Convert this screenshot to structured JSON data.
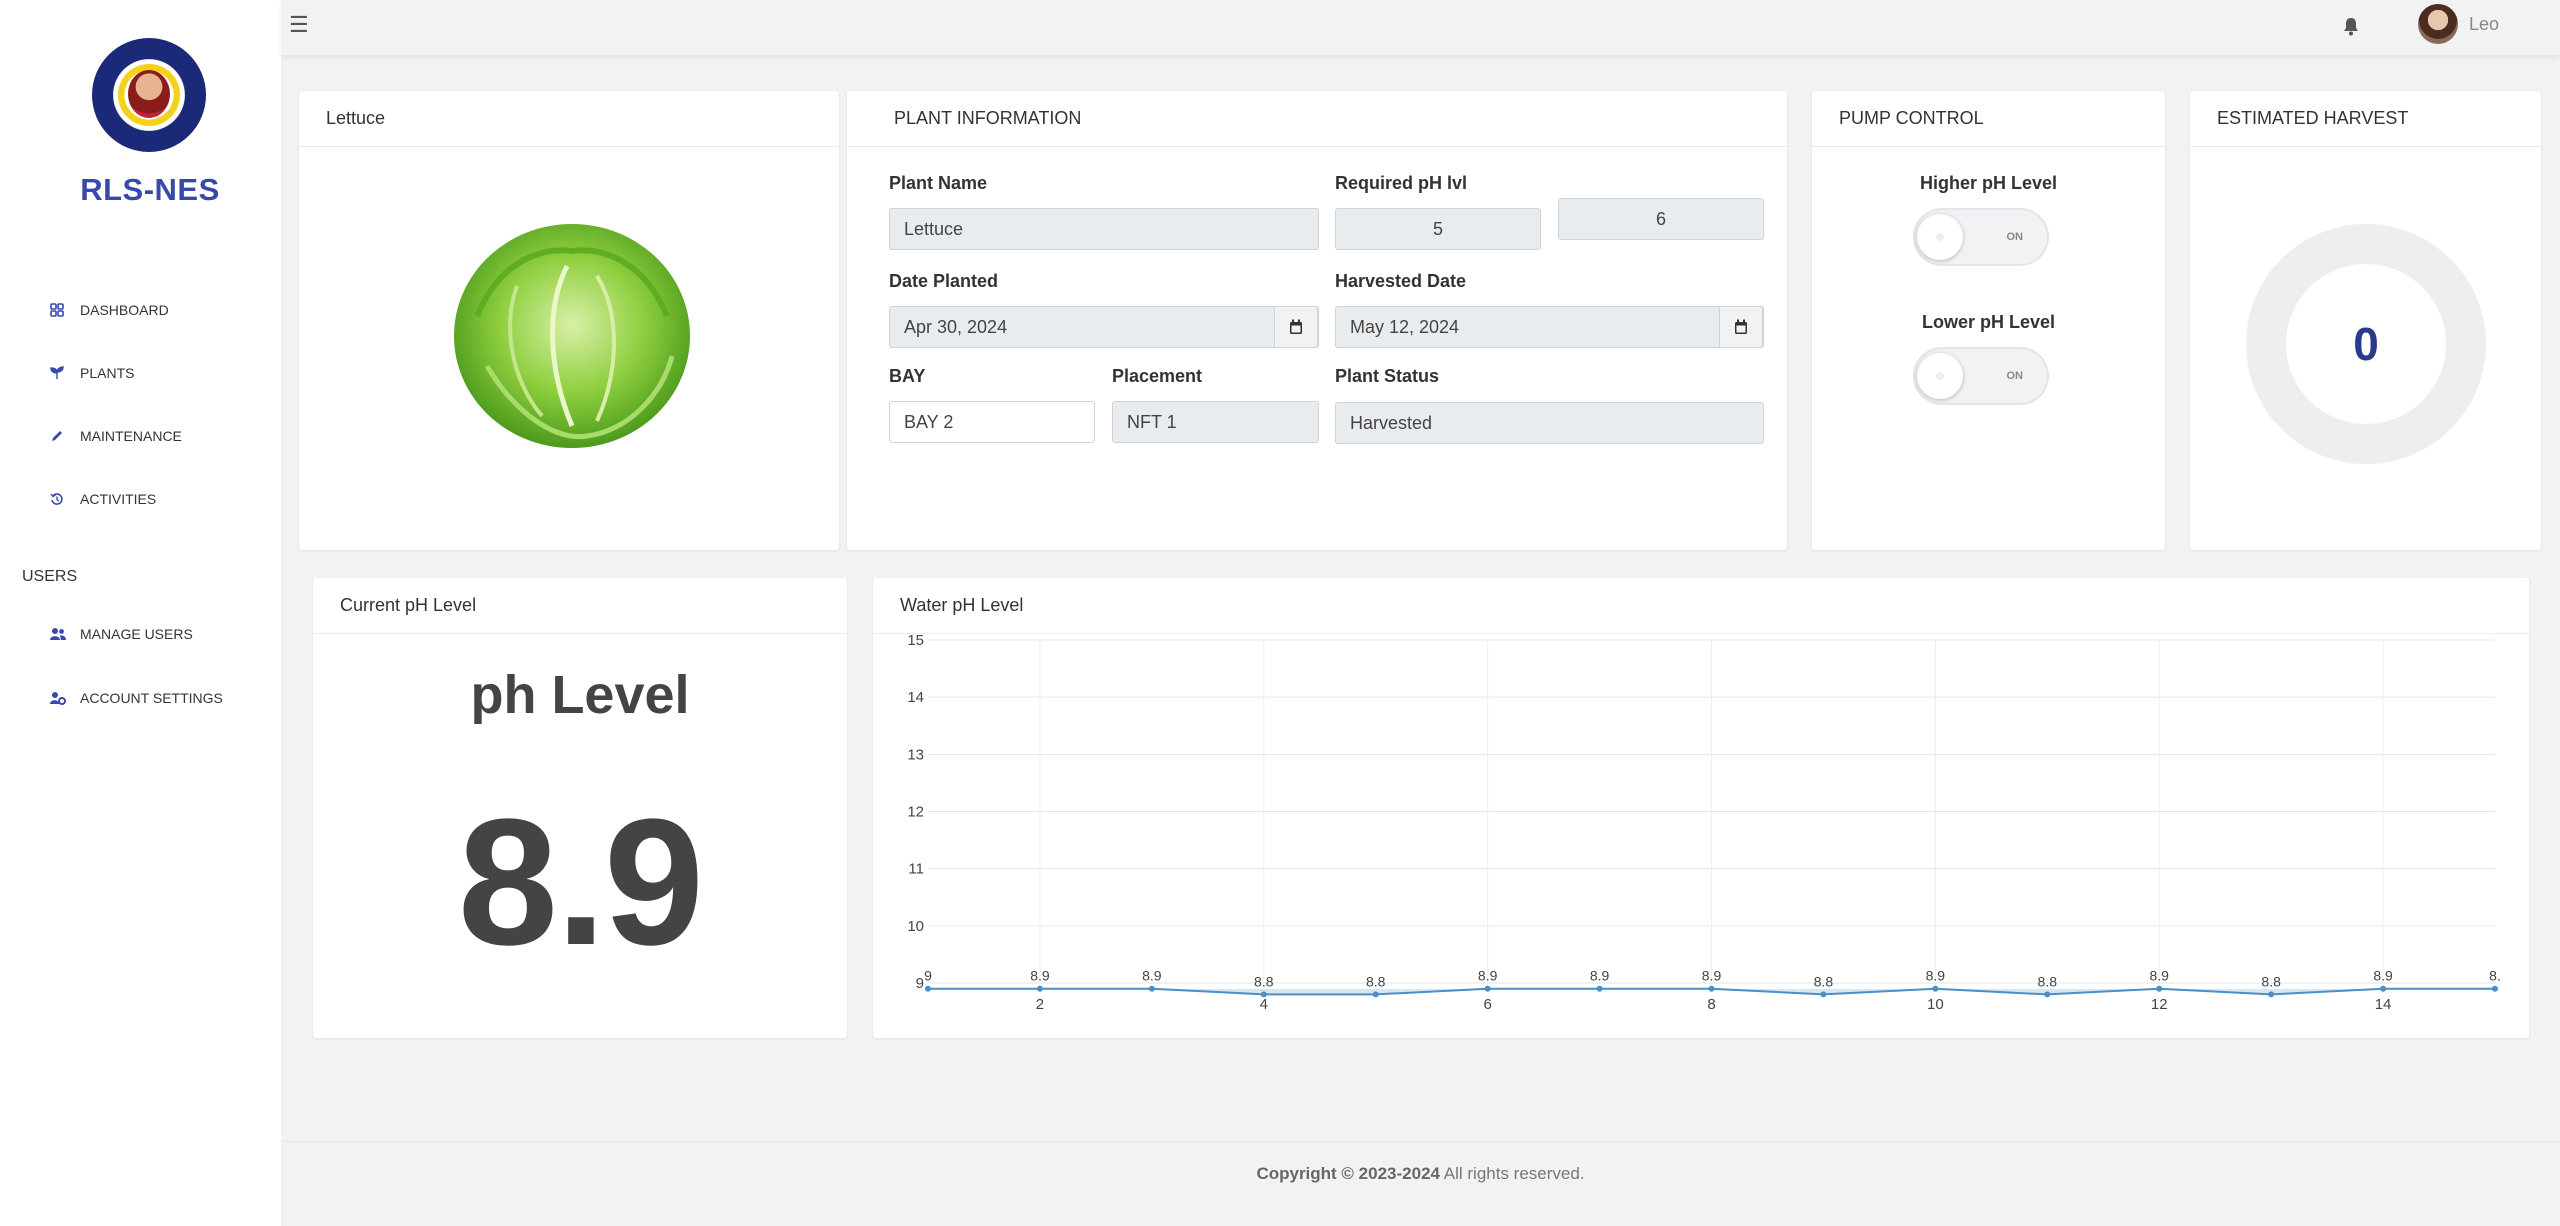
{
  "sidebar": {
    "brand": "RLS-NES",
    "items": [
      {
        "label": "DASHBOARD",
        "icon": "dashboard-icon"
      },
      {
        "label": "PLANTS",
        "icon": "sprout-icon"
      },
      {
        "label": "MAINTENANCE",
        "icon": "pencil-icon"
      },
      {
        "label": "ACTIVITIES",
        "icon": "history-icon"
      }
    ],
    "users_section": "USERS",
    "user_items": [
      {
        "label": "MANAGE USERS",
        "icon": "users-icon"
      },
      {
        "label": "ACCOUNT SETTINGS",
        "icon": "user-gear-icon"
      }
    ]
  },
  "topbar": {
    "username": "Leo"
  },
  "plant_card": {
    "title": "Lettuce"
  },
  "plant_info": {
    "title": "PLANT INFORMATION",
    "plant_name_label": "Plant Name",
    "plant_name": "Lettuce",
    "required_ph_label": "Required pH lvl",
    "required_ph_min": "5",
    "required_ph_max": "6",
    "date_planted_label": "Date Planted",
    "date_planted": "Apr 30, 2024",
    "harvested_date_label": "Harvested Date",
    "harvested_date": "May 12, 2024",
    "bay_label": "BAY",
    "bay": "BAY 2",
    "placement_label": "Placement",
    "placement": "NFT 1",
    "status_label": "Plant Status",
    "status": "Harvested"
  },
  "pump_control": {
    "title": "PUMP CONTROL",
    "higher_label": "Higher pH Level",
    "lower_label": "Lower pH Level",
    "on_text": "ON"
  },
  "estimated_harvest": {
    "title": "ESTIMATED HARVEST",
    "value": "0"
  },
  "current_ph": {
    "title": "Current pH Level",
    "heading": "ph Level",
    "value": "8.9"
  },
  "water_ph": {
    "title": "Water pH Level"
  },
  "chart_data": {
    "type": "area",
    "title": "Water pH Level",
    "x": [
      1,
      2,
      3,
      4,
      5,
      6,
      7,
      8,
      9,
      10,
      11,
      12,
      13,
      14,
      15
    ],
    "values": [
      8.9,
      8.9,
      8.9,
      8.8,
      8.8,
      8.9,
      8.9,
      8.9,
      8.8,
      8.9,
      8.8,
      8.9,
      8.8,
      8.9,
      8.9
    ],
    "point_labels": [
      "9",
      "8.9",
      "8.9",
      "8.8",
      "8.8",
      "8.9",
      "8.9",
      "8.9",
      "8.8",
      "8.9",
      "8.8",
      "8.9",
      "8.8",
      "8.9",
      "8."
    ],
    "x_ticks": [
      "2",
      "4",
      "6",
      "8",
      "10",
      "12",
      "14"
    ],
    "y_ticks": [
      "9",
      "10",
      "11",
      "12",
      "13",
      "14",
      "15"
    ],
    "xlim": [
      1,
      15
    ],
    "ylim": [
      9,
      15
    ],
    "color": "#4a8fc7",
    "grid": true
  },
  "footer": {
    "copyright": "Copyright © 2023-2024",
    "rights": " All rights reserved."
  },
  "colors": {
    "accent": "#3949ab",
    "gauge_value": "#2a3a8c"
  }
}
